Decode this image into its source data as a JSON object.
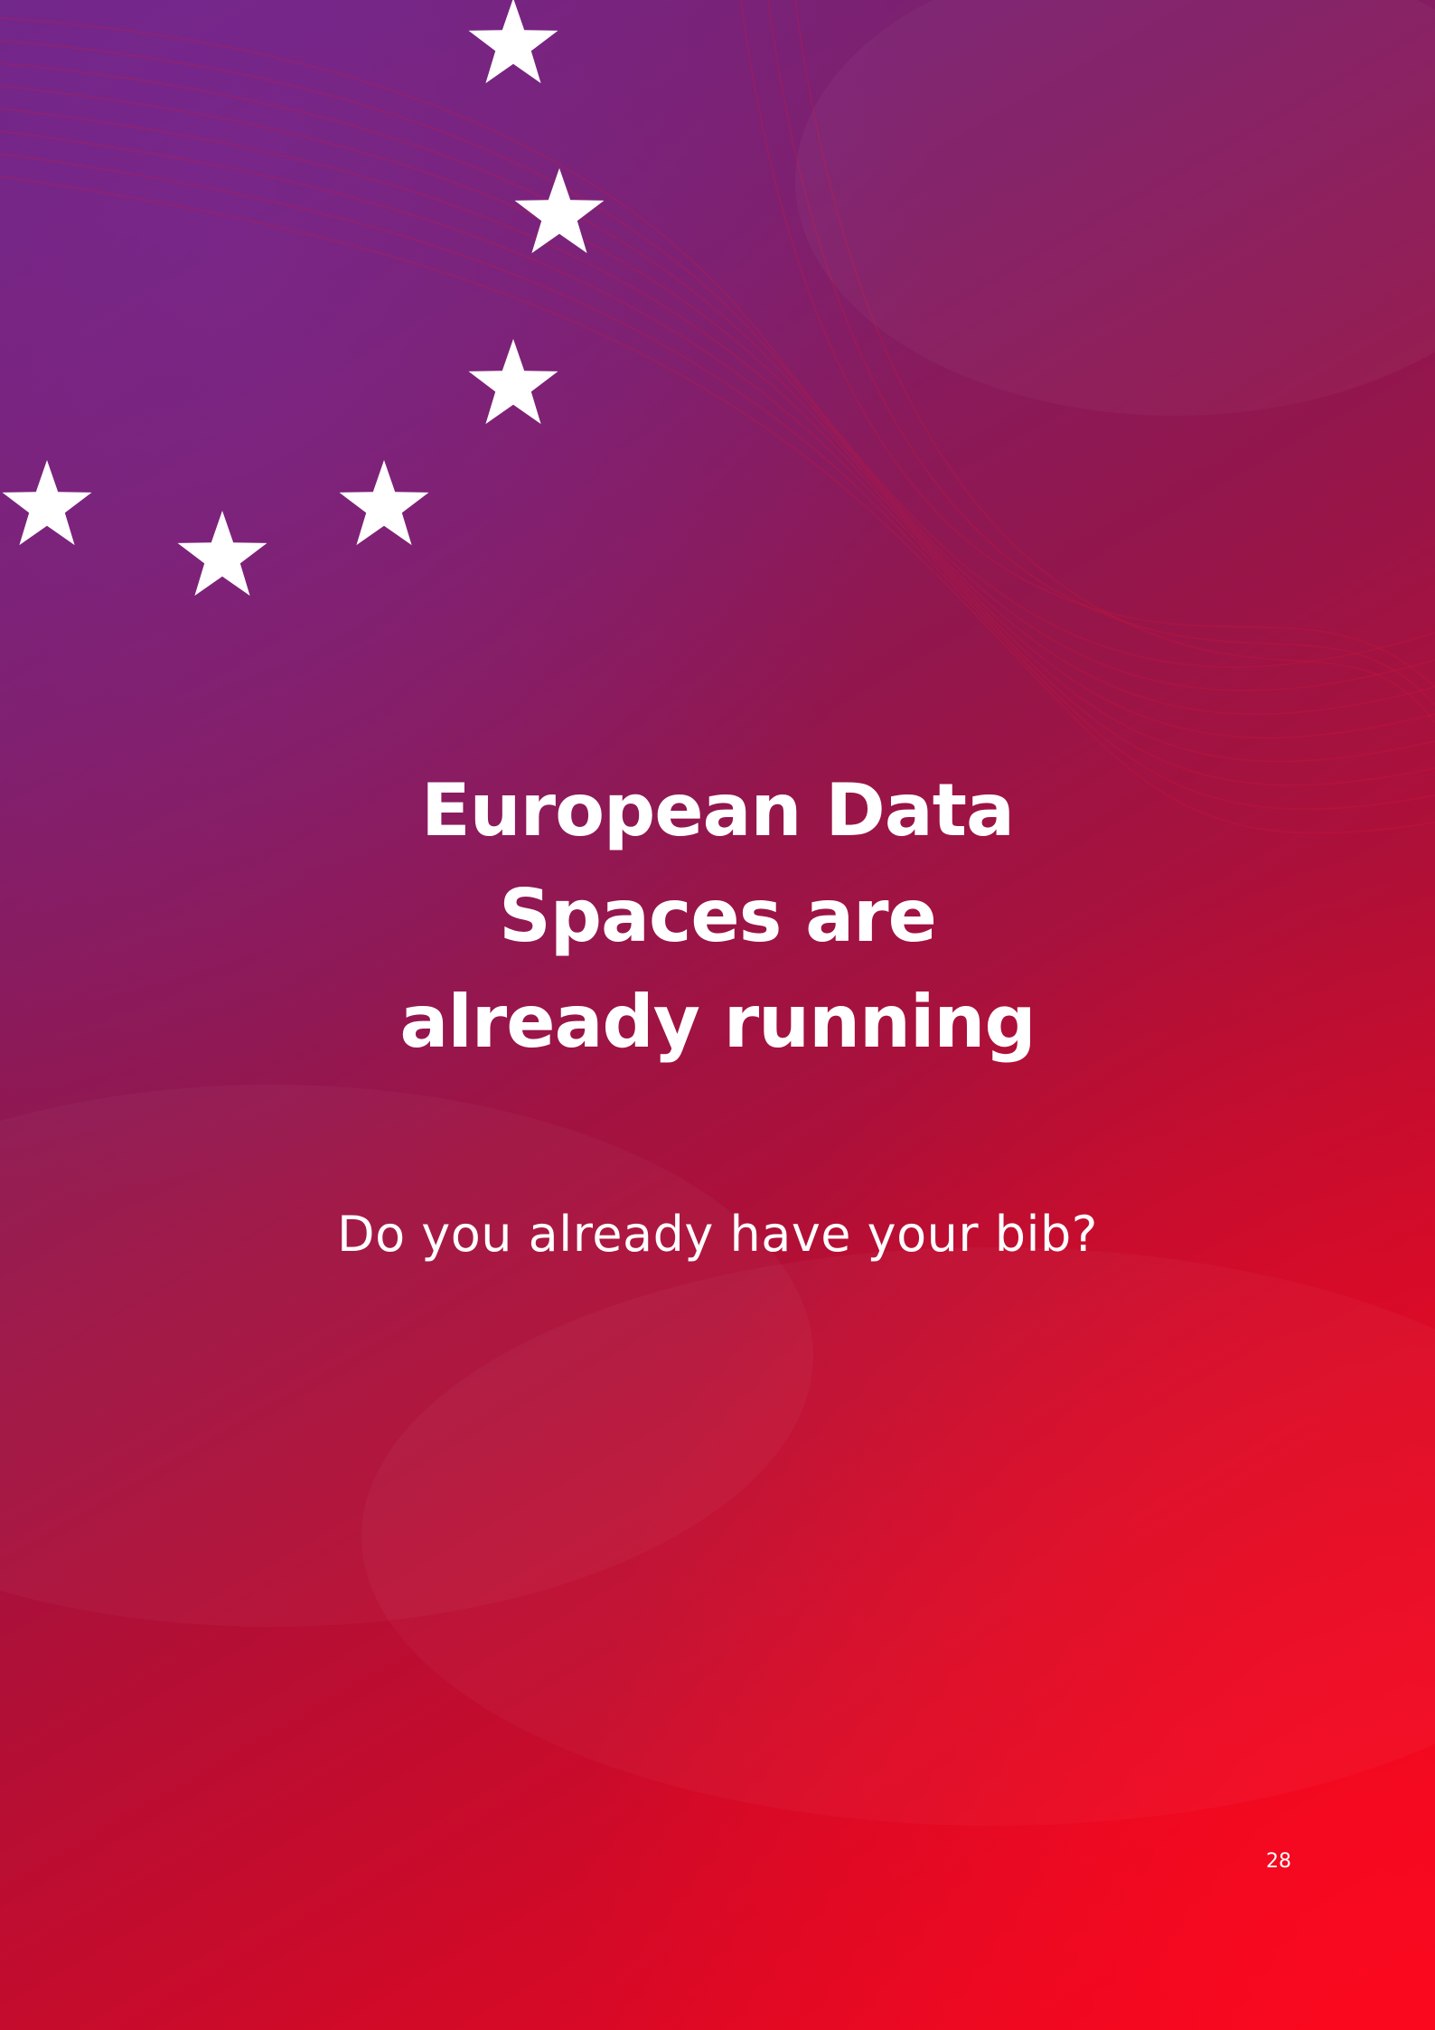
{
  "page": {
    "title_lines": [
      "European Data",
      "Spaces are",
      "already running"
    ],
    "subtitle": "Do you already have your bib?",
    "page_number": "28"
  },
  "colors": {
    "gradient_top_left": "#6e2585",
    "gradient_bottom_right": "#f2061e",
    "text": "#ffffff",
    "stars": "#ffffff"
  },
  "icons": {
    "star_count": 6,
    "star": "star-icon"
  }
}
